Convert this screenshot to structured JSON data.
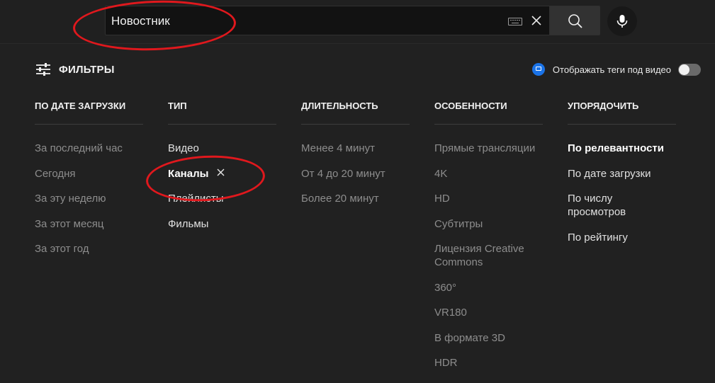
{
  "search": {
    "query": "Новостник"
  },
  "filters": {
    "title": "ФИЛЬТРЫ",
    "tags_toggle_label": "Отображать теги под видео",
    "tags_toggle_on": false
  },
  "colors": {
    "background": "#212121",
    "annotation": "#e0181d",
    "text_primary": "#f1f1f1",
    "text_muted": "#8d8d8d"
  },
  "icons": {
    "filters": "sliders-icon",
    "keyboard": "keyboard-icon",
    "clear": "close-icon",
    "search": "search-icon",
    "mic": "microphone-icon",
    "extension": "extension-icon",
    "remove_filter": "close-icon"
  },
  "columns": [
    {
      "header": "ПО ДАТЕ ЗАГРУЗКИ",
      "items": [
        "За последний час",
        "Сегодня",
        "За эту неделю",
        "За этот месяц",
        "За этот год"
      ]
    },
    {
      "header": "ТИП",
      "items": [
        "Видео",
        "Каналы",
        "Плейлисты",
        "Фильмы"
      ],
      "selected_index": 1
    },
    {
      "header": "ДЛИТЕЛЬНОСТЬ",
      "items": [
        "Менее 4 минут",
        "От 4 до 20 минут",
        "Более 20 минут"
      ]
    },
    {
      "header": "ОСОБЕННОСТИ",
      "items": [
        "Прямые трансляции",
        "4K",
        "HD",
        "Субтитры",
        "Лицензия Creative Commons",
        "360°",
        "VR180",
        "В формате 3D",
        "HDR"
      ]
    },
    {
      "header": "УПОРЯДОЧИТЬ",
      "items": [
        "По релевантности",
        "По дате загрузки",
        "По числу просмотров",
        "По рейтингу"
      ],
      "selected_index": 0
    }
  ]
}
